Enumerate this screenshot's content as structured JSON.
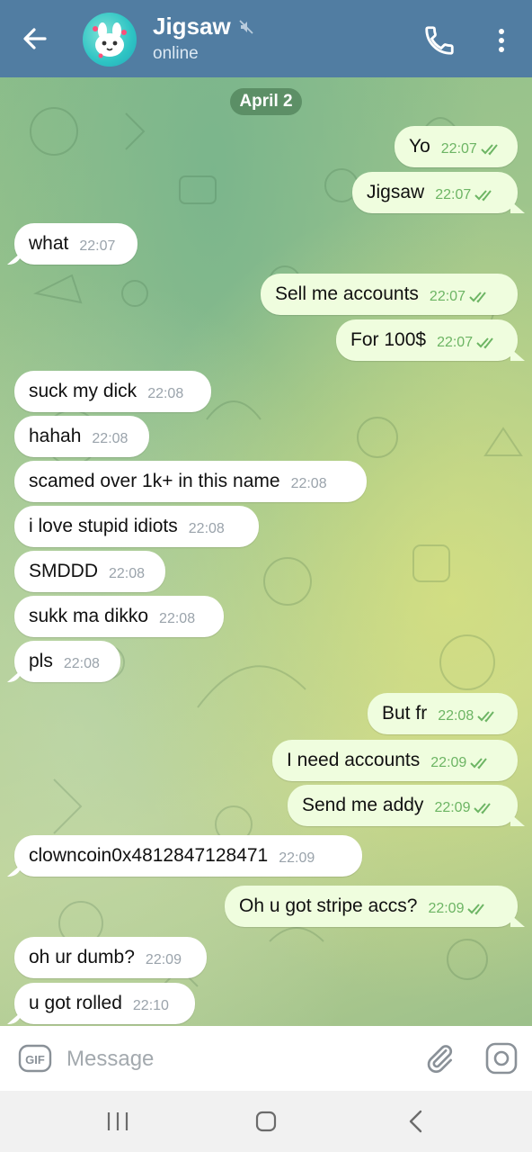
{
  "header": {
    "contact_name": "Jigsaw",
    "status": "online",
    "icons": [
      "back-arrow-icon",
      "mute-icon",
      "phone-icon",
      "more-vert-icon"
    ],
    "color": "#517da2"
  },
  "chat": {
    "date_label": "April 2",
    "messages": [
      {
        "dir": "out",
        "text": "Yo",
        "time": "22:07",
        "read": true
      },
      {
        "dir": "out",
        "text": "Jigsaw",
        "time": "22:07",
        "read": true
      },
      {
        "dir": "in",
        "text": "what",
        "time": "22:07"
      },
      {
        "dir": "out",
        "text": "Sell me accounts",
        "time": "22:07",
        "read": true
      },
      {
        "dir": "out",
        "text": "For 100$",
        "time": "22:07",
        "read": true
      },
      {
        "dir": "in",
        "text": "suck my dick",
        "time": "22:08"
      },
      {
        "dir": "in",
        "text": "hahah",
        "time": "22:08"
      },
      {
        "dir": "in",
        "text": "scamed over 1k+ in this name",
        "time": "22:08"
      },
      {
        "dir": "in",
        "text": "i love stupid idiots",
        "time": "22:08"
      },
      {
        "dir": "in",
        "text": "SMDDD",
        "time": "22:08"
      },
      {
        "dir": "in",
        "text": "sukk ma dikko",
        "time": "22:08"
      },
      {
        "dir": "in",
        "text": "pls",
        "time": "22:08"
      },
      {
        "dir": "out",
        "text": "But fr",
        "time": "22:08",
        "read": true
      },
      {
        "dir": "out",
        "text": "I need accounts",
        "time": "22:09",
        "read": true
      },
      {
        "dir": "out",
        "text": "Send me addy",
        "time": "22:09",
        "read": true
      },
      {
        "dir": "in",
        "text": "clowncoin0x4812847128471",
        "time": "22:09"
      },
      {
        "dir": "out",
        "text": "Oh u got stripe accs?",
        "time": "22:09",
        "read": true
      },
      {
        "dir": "in",
        "text": "oh ur dumb?",
        "time": "22:09"
      },
      {
        "dir": "in",
        "text": "u got rolled",
        "time": "22:10"
      }
    ],
    "colors": {
      "incoming": "#ffffff",
      "outgoing": "#effdde",
      "read_check": "#6db564"
    }
  },
  "composer": {
    "placeholder": "Message",
    "gif_label": "GIF",
    "icons": [
      "paperclip-icon",
      "camera-icon"
    ]
  },
  "navbar": {
    "icons": [
      "recents-icon",
      "home-icon",
      "back-icon"
    ]
  }
}
